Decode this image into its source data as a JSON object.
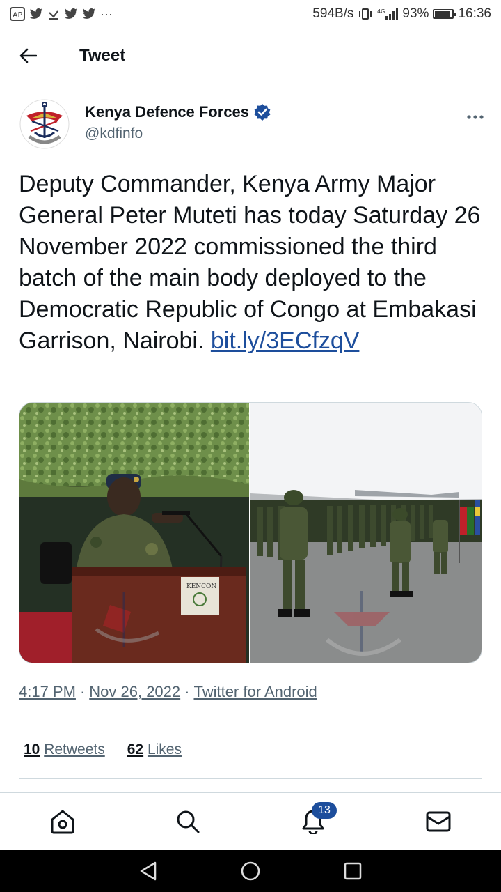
{
  "status_bar": {
    "net_speed": "594B/s",
    "battery_pct": "93%",
    "battery_level": 0.93,
    "time": "16:36",
    "left_icons": [
      "app-icon",
      "twitter-icon",
      "download-icon",
      "twitter-icon",
      "twitter-icon",
      "more-notifications-icon"
    ]
  },
  "header": {
    "title": "Tweet"
  },
  "author": {
    "name": "Kenya Defence Forces",
    "handle": "@kdfinfo"
  },
  "tweet": {
    "text": "Deputy Commander, Kenya Army Major General Peter Muteti has today Saturday 26 November 2022 commissioned the third batch of the main body deployed to the Democratic Republic of Congo at Embakasi Garrison, Nairobi.",
    "link": "bit.ly/3ECfzqV"
  },
  "media": {
    "left_podium_sign": "KENCON",
    "watermark": "KENYA DEFENCE FORCES"
  },
  "meta": {
    "time": "4:17 PM",
    "date": "Nov 26, 2022",
    "source": "Twitter for Android"
  },
  "stats": {
    "retweets_count": "10",
    "retweets_label": "Retweets",
    "likes_count": "62",
    "likes_label": "Likes"
  },
  "bottom_nav": {
    "notifications_badge": "13"
  },
  "colors": {
    "link": "#1d4e9c",
    "verified": "#1d4e9c",
    "secondary_text": "#536471",
    "divider": "#cfd9de"
  }
}
